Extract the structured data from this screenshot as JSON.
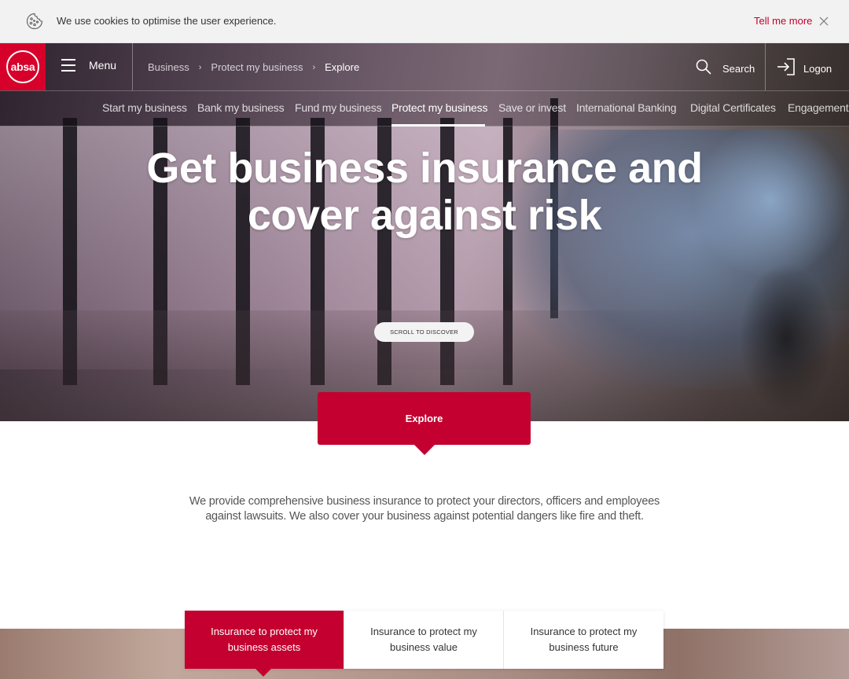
{
  "cookie_bar": {
    "text": "We use cookies to optimise the user experience.",
    "more_label": "Tell me more",
    "icon": "cookie-icon",
    "close_icon": "close-icon"
  },
  "header": {
    "logo_text": "absa",
    "menu_label": "Menu",
    "breadcrumb": [
      "Business",
      "Protect my business",
      "Explore"
    ],
    "search_label": "Search",
    "logon_label": "Logon"
  },
  "subnav": {
    "items": [
      "Start my business",
      "Bank my business",
      "Fund my business",
      "Protect my business",
      "Save or invest",
      "International Banking",
      "Digital Certificates",
      "Engagement"
    ],
    "active": "Protect my business"
  },
  "hero": {
    "title_line1": "Get business insurance and",
    "title_line2": "cover against risk",
    "scroll_label": "SCROLL TO DISCOVER"
  },
  "explore": {
    "label": "Explore"
  },
  "intro": {
    "text": "We provide comprehensive business insurance to protect your directors, officers and employees against lawsuits. We also cover your business against potential dangers like fire and theft."
  },
  "tabs": {
    "items": [
      "Insurance to protect my business assets",
      "Insurance to protect my business value",
      "Insurance to protect my business future"
    ],
    "active_index": 0
  },
  "colors": {
    "brand_red": "#c3002f",
    "logo_red": "#d6002a"
  }
}
